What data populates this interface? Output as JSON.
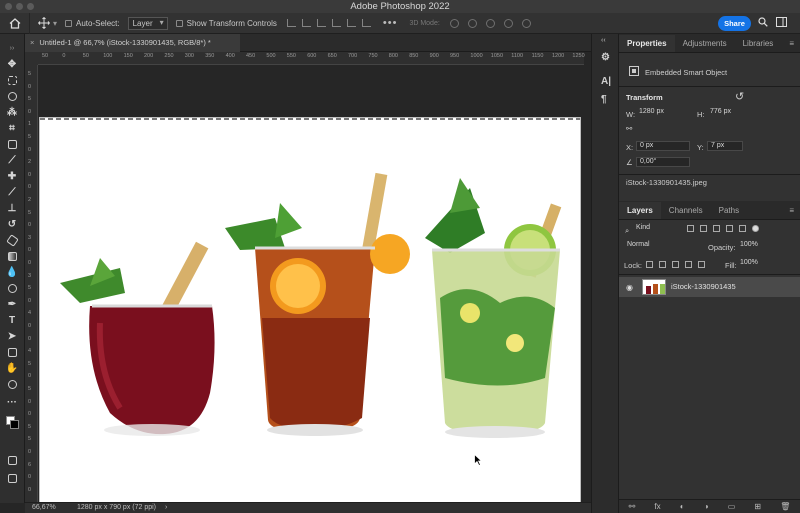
{
  "app": {
    "title": "Adobe Photoshop 2022"
  },
  "options": {
    "auto_select_label": "Auto-Select:",
    "layer_select": "Layer",
    "transform_controls_label": "Show Transform Controls",
    "more": "•••",
    "mode_3d": "3D Mode:",
    "share_label": "Share"
  },
  "document": {
    "tab_title": "Untitled-1 @ 66,7% (iStock-1330901435, RGB/8*) *",
    "close": "×"
  },
  "ruler": {
    "top_ticks": [
      "50",
      "0",
      "50",
      "100",
      "150",
      "200",
      "250",
      "300",
      "350",
      "400",
      "450",
      "500",
      "550",
      "600",
      "650",
      "700",
      "750",
      "800",
      "850",
      "900",
      "950",
      "1000",
      "1050",
      "1100",
      "1150",
      "1200",
      "1250"
    ],
    "left_ticks": [
      "5",
      "0",
      "5",
      "0",
      "1",
      "5",
      "0",
      "2",
      "0",
      "0",
      "2",
      "5",
      "0",
      "3",
      "0",
      "0",
      "3",
      "5",
      "0",
      "4",
      "0",
      "0",
      "4",
      "5",
      "0",
      "5",
      "0",
      "0",
      "5",
      "5",
      "0",
      "6",
      "0",
      "0"
    ]
  },
  "status": {
    "zoom": "66,67%",
    "doc_info": "1280 px x 790 px (72 ppi)",
    "arrow": "›"
  },
  "properties": {
    "tabs": [
      "Properties",
      "Adjustments",
      "Libraries"
    ],
    "kind": "Embedded Smart Object",
    "transform_title": "Transform",
    "w_label": "W:",
    "w_value": "1280 px",
    "h_label": "H:",
    "h_value": "776 px",
    "x_label": "X:",
    "x_value": "0 px",
    "y_label": "Y:",
    "y_value": "7 px",
    "angle_value": "0,00°",
    "filename": "iStock-1330901435.jpeg"
  },
  "layers": {
    "tabs": [
      "Layers",
      "Channels",
      "Paths"
    ],
    "filter_kind": "Kind",
    "blend_mode": "Normal",
    "opacity_label": "Opacity:",
    "opacity_value": "100%",
    "lock_label": "Lock:",
    "fill_label": "Fill:",
    "fill_value": "100%",
    "layer_name": "iStock-1330901435",
    "footer_icons": [
      "link-icon",
      "fx-icon",
      "mask-icon",
      "adjustment-icon",
      "group-icon",
      "new-layer-icon",
      "trash-icon"
    ],
    "footer_fx": "fx"
  },
  "colors": {
    "accent": "#1473e6",
    "panel": "#323232",
    "canvas_bg": "#262626"
  }
}
